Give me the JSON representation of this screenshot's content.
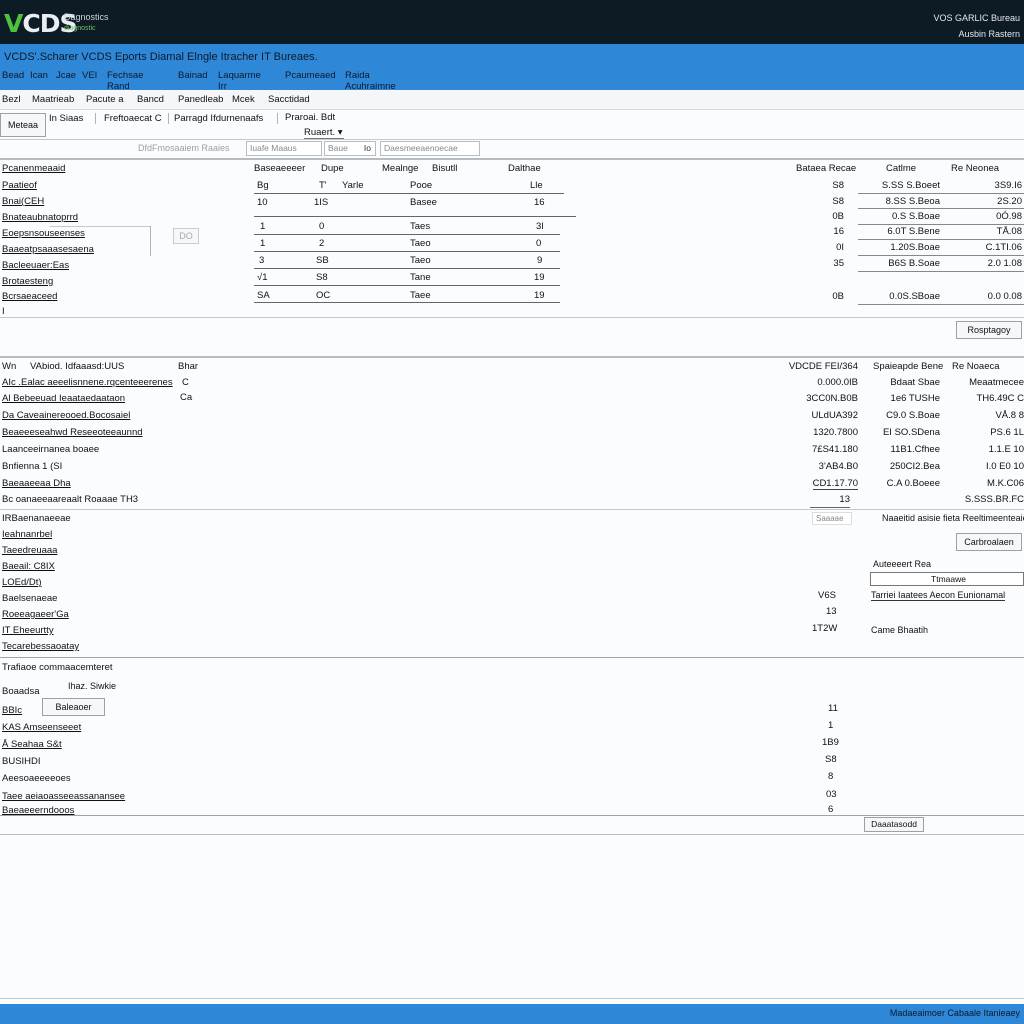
{
  "header": {
    "logo": {
      "v": "V",
      "rest": "CDS"
    },
    "brand_line1": "Dagnostics",
    "brand_line2": "diagnostic",
    "right_line1": "VOS GARLIC Bureau",
    "right_line2": "Ausbin Rastern"
  },
  "title_bar": {
    "title": "VCDS'.Scharer VCDS Eports Diamal Elngle Itracher IT Bureaes."
  },
  "menu": [
    "Bead",
    "Ican",
    "Jcae",
    "VEI",
    "Fechsae Rand",
    "Bainad",
    "Laquarme Irr",
    "Pcaumeaed",
    "Raida Acuhraimne"
  ],
  "toolbar": [
    "Bezl",
    "Maatrieab",
    "Pacute a",
    "Bancd",
    "Panedleab",
    "Mcek",
    "Sacctidad"
  ],
  "controls": {
    "left_button": "Meteaa",
    "link_1": "In Siaas",
    "link_2": "Freftoaecat C",
    "link_3": "Parragd Ifdurnenaafs",
    "filter_title": "Praroai. Bdt",
    "select_value": "Ruaert.",
    "field_label": "DfdFmosaaiem Raaies",
    "input_1": "Iuafe Maaus",
    "input_2": "Baue",
    "input_2_value": "Io",
    "input_3": "Daesmeeaenoecae"
  },
  "section1": {
    "row_labels": [
      "Pcanenmeaaid",
      "Paatieof",
      "Bnai(CEH",
      "Bnateaubnatoprrd",
      "Eoepsnsouseenses",
      "Baaeatpsaaasesaena",
      "Bacleeuaer:Eas",
      "Brotaesteng",
      "Bcrsaeaceed",
      "I"
    ],
    "small_btn": "DO",
    "col_headers": [
      "Baseaeeeer",
      "Dupe",
      "Mealnge",
      "Bisutll",
      "Dalthae"
    ],
    "rows": [
      [
        "Bg",
        "T'",
        "Yarle",
        "Pooe",
        "Lle"
      ],
      [
        "10",
        "1IS",
        "",
        "Basee",
        "16"
      ],
      [
        "1",
        "0",
        "",
        "Taes",
        "3I"
      ],
      [
        "1",
        "2",
        "",
        "Taeo",
        "0"
      ],
      [
        "3",
        "SB",
        "",
        "Taeo",
        "9"
      ],
      [
        "√1",
        "S8",
        "",
        "Tane",
        "19"
      ],
      [
        "SA",
        "OC",
        "",
        "Taee",
        "19"
      ]
    ],
    "right_headers": [
      "Bataea Recae",
      "Catlme",
      "Re Neonea"
    ],
    "right_rows": [
      [
        "S8",
        "S.SS S.Boeet",
        "3S9.I6"
      ],
      [
        "S8",
        "8.SS S.Beoa",
        "2S.20"
      ],
      [
        "0B",
        "0.S S.Boae",
        "0Ó.98"
      ],
      [
        "16",
        "6.0T S.Bene",
        "TÅ.08"
      ],
      [
        "0I",
        "1.20S.Boae",
        "C.1TI.06"
      ],
      [
        "35",
        "B6S B.Soae",
        "2.0 1.08"
      ],
      [
        "0B",
        "0.0S.SBoae",
        "0.0 0.08"
      ]
    ],
    "footer_btn": "Rosptagoy"
  },
  "section2": {
    "head_left": "Wn",
    "head_mid": "VAbiod. Idfaaasd:UUS",
    "head_col": "Bhar",
    "head_right": "VDCDE FEI/364",
    "right_headers": [
      "Spaieapde Bene",
      "Re Noaeca"
    ],
    "rows": [
      {
        "label": "AIc .Ealac aeeelisnnene.rqcenteeerenes",
        "flag": "C",
        "value": "0.000.0IB",
        "c1": "Bdaat Sbae",
        "c2": "Meaatmecee"
      },
      {
        "label": "Al Bebeeuad Ieaataedaataon",
        "flag": "Ca",
        "value": "3CC0N.B0B",
        "c1": "1e6 TUSHe",
        "c2": "TH6.49C C"
      },
      {
        "label": "Da Caveainereooed.Bocosaiel",
        "flag": "",
        "value": "ULdUA392",
        "c1": "C9.0 S.Boae",
        "c2": "VÅ.8 8"
      },
      {
        "label": "Beaeeeseahwd Reseeoteeaunnd",
        "flag": "",
        "value": "1320.7800",
        "c1": "EI SO.SDena",
        "c2": "PS.6 1L"
      },
      {
        "label": "Laanceeirnanea boaee",
        "flag": "",
        "value": "7£S41.180",
        "c1": "11B1.Cfhee",
        "c2": "1.1.E 10"
      },
      {
        "label": "Bnfienna 1 (SI",
        "flag": "",
        "value": "3'AB4.B0",
        "c1": "250CI2.Bea",
        "c2": "I.0 E0 10"
      },
      {
        "label": "Baeaaeeaa Dha",
        "flag": "",
        "value": "CD1.17.70",
        "c1": "C.A 0.Boeee",
        "c2": "M.K.C06"
      },
      {
        "label": "Bc oanaeeaareaalt Roaaae TH3",
        "flag": "",
        "value": "13",
        "c1": "",
        "c2": "S.SSS.BR.FC"
      }
    ],
    "below_labels": [
      "IRBaenanaeeae",
      "Ieahnanrbel",
      "Taeedreuaaa",
      "Baeail: C8IX",
      "LOEd/Dt)",
      "Baelsenaeae",
      "Roeeagaeer'Ga",
      "IT Eheeurtty",
      "Tecarebessaoatay"
    ],
    "search_placeholder": "Saaaae",
    "search_note": "Naaeitid asisie fieta Reeltimeenteaiehn",
    "btn": "Carbroalaen",
    "right_box_title": "Auteeeert Rea",
    "right_box_field": "Ttmaawe",
    "right_box_sel": "Tarriei Iaatees Aecon Eunionamal",
    "nums": [
      "V6S",
      "13",
      "1T2W"
    ],
    "right_text": "Came Bhaatih"
  },
  "section3": {
    "title": "Trafiaoe commaacemteret",
    "subtitle": "Ihaz. Siwkie",
    "left_labels": [
      "Boaadsa",
      "BBIc",
      "KAS Amseenseeet",
      "Å Seahaa S&t",
      "BUSIHDI",
      "Aeesoaeeeeoes",
      "Taee aeiaoasseeassanansee",
      "Baeaeeerndooos"
    ],
    "btn": "Baleaoer",
    "nums": [
      "11",
      "1",
      "1B9",
      "S8",
      "8",
      "03",
      "6"
    ],
    "footer_btn": "Daaatasodd"
  },
  "footer": {
    "text": "Madaeaimoer Cabaale Itanieaey"
  }
}
